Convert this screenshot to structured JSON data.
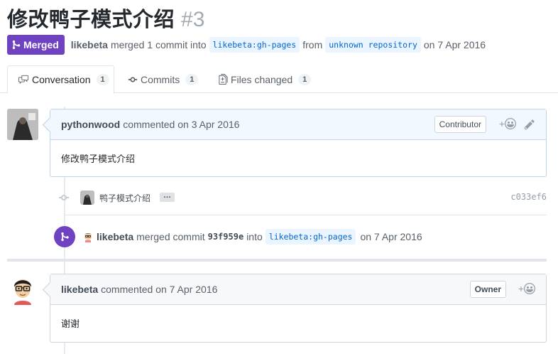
{
  "pr": {
    "title": "修改鸭子模式介绍",
    "number": "#3",
    "state": "Merged",
    "merger": "likebeta",
    "merged_text": "merged 1 commit into",
    "base_ref": "likebeta:gh-pages",
    "from_text": "from",
    "head_ref": "unknown repository",
    "date_text": "on 7 Apr 2016"
  },
  "tabs": [
    {
      "label": "Conversation",
      "count": "1"
    },
    {
      "label": "Commits",
      "count": "1"
    },
    {
      "label": "Files changed",
      "count": "1"
    }
  ],
  "comment1": {
    "author": "pythonwood",
    "when": "commented on 3 Apr 2016",
    "role": "Contributor",
    "body": "修改鸭子模式介绍",
    "react": "+"
  },
  "commit": {
    "message": "鸭子模式介绍",
    "ellipsis": "…",
    "sha": "c033ef6"
  },
  "merge_event": {
    "actor": "likebeta",
    "text1": "merged commit",
    "sha": "93f959e",
    "text2": "into",
    "ref": "likebeta:gh-pages",
    "date": "on 7 Apr 2016"
  },
  "comment2": {
    "author": "likebeta",
    "when": "commented on 7 Apr 2016",
    "role": "Owner",
    "body": "谢谢",
    "react": "+"
  },
  "colors": {
    "merged": "#6f42c1",
    "link": "#0366d6",
    "ref_bg": "#eaf5ff"
  }
}
